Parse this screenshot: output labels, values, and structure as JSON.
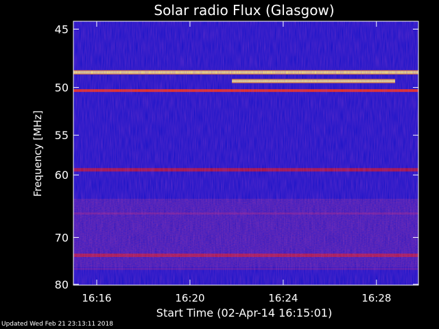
{
  "chart_data": {
    "type": "heatmap",
    "title": "Solar radio Flux (Glasgow)",
    "xlabel": "Start Time (02-Apr-14 16:15:01)",
    "ylabel": "Frequency [MHz]",
    "x_tick_labels": [
      "16:16",
      "16:20",
      "16:24",
      "16:28"
    ],
    "x_tick_minutes": [
      1,
      5,
      9,
      13
    ],
    "x_range_minutes": [
      0,
      14.8
    ],
    "y_tick_labels": [
      "45",
      "50",
      "55",
      "60",
      "70",
      "80"
    ],
    "y_tick_values": [
      45,
      50,
      55,
      60,
      70,
      80
    ],
    "y_range": [
      44.4,
      80.2
    ],
    "y_scale": "reciprocal",
    "colormap": [
      "#000040",
      "#0000a0",
      "#1a1aff",
      "#6a1a9a",
      "#b01030",
      "#ff3000",
      "#ff9000",
      "#ffff80",
      "#ffffff"
    ],
    "emission_bands": [
      {
        "freq_mhz": 48.6,
        "level": "very high",
        "x_range_minutes": [
          0,
          14.8
        ]
      },
      {
        "freq_mhz": 49.4,
        "level": "very high",
        "x_range_minutes": [
          6.8,
          13.8
        ]
      },
      {
        "freq_mhz": 50.3,
        "level": "high",
        "x_range_minutes": [
          0,
          14.8
        ]
      },
      {
        "freq_mhz": 59.3,
        "level": "medium",
        "x_range_minutes": [
          0,
          14.8
        ]
      },
      {
        "freq_mhz": 65.8,
        "level": "low",
        "x_range_minutes": [
          0,
          14.8
        ]
      },
      {
        "freq_mhz": 73.5,
        "level": "medium",
        "x_range_minutes": [
          0,
          14.8
        ]
      },
      {
        "freq_mhz": 76.4,
        "level": "low",
        "x_range_minutes": [
          0,
          14.8
        ]
      }
    ]
  },
  "footer": {
    "updated": "Updated Wed Feb 21 23:13:11 2018"
  }
}
